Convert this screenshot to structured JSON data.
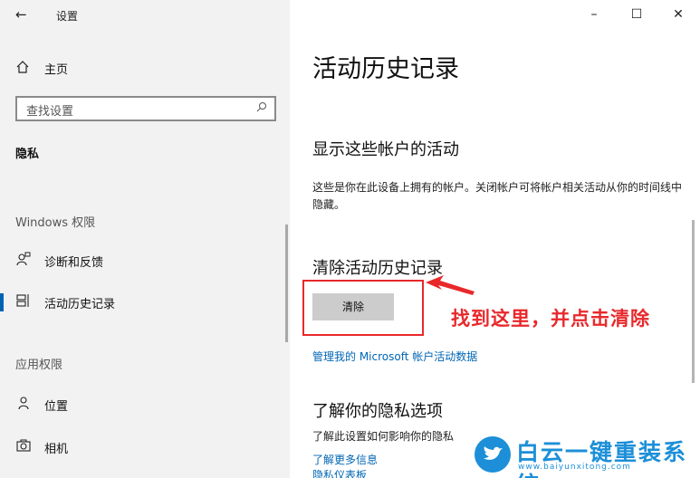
{
  "window": {
    "title": "设置",
    "minimize_icon": "minimize-icon",
    "maximize_icon": "maximize-icon",
    "close_icon": "close-icon"
  },
  "sidebar": {
    "home_label": "主页",
    "search_placeholder": "查找设置",
    "current_section": "隐私",
    "windows_group": "Windows 权限",
    "app_group": "应用权限",
    "items": [
      {
        "label": "诊断和反馈",
        "icon": "feedback-person-icon"
      },
      {
        "label": "活动历史记录",
        "icon": "activity-timeline-icon",
        "selected": true
      },
      {
        "label": "位置",
        "icon": "location-person-icon"
      },
      {
        "label": "相机",
        "icon": "camera-icon"
      }
    ]
  },
  "main": {
    "title": "活动历史记录",
    "accounts_heading": "显示这些帐户的活动",
    "accounts_desc": "这些是你在此设备上拥有的帐户。关闭帐户可将帐户相关活动从你的时间线中隐藏。",
    "clear_heading": "清除活动历史记录",
    "clear_button": "清除",
    "manage_link": "管理我的 Microsoft 帐户活动数据",
    "privacy_heading": "了解你的隐私选项",
    "privacy_desc": "了解此设置如何影响你的隐私",
    "learn_more_link": "了解更多信息",
    "dashboard_link": "隐私仪表板"
  },
  "annotation": {
    "text": "找到这里，并点击清除",
    "color": "#e8282b"
  },
  "watermark": {
    "name": "白云一键重装系统",
    "url": "www.baiyunxitong.com",
    "color": "#1c8fd8"
  },
  "colors": {
    "accent": "#0063b1",
    "link": "#0066b4",
    "sidebar_bg": "#f2f2f2",
    "button_bg": "#cccccc"
  }
}
